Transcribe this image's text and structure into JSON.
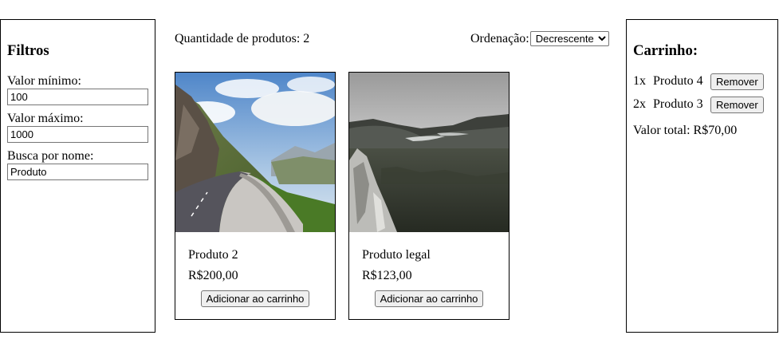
{
  "filters": {
    "title": "Filtros",
    "min_label": "Valor mínimo:",
    "min_value": "100",
    "max_label": "Valor máximo:",
    "max_value": "1000",
    "name_label": "Busca por nome:",
    "name_value": "Produto"
  },
  "header": {
    "quantity_text": "Quantidade de produtos: 2",
    "sort_label": "Ordenação:",
    "sort_selected": "Decrescente"
  },
  "products": [
    {
      "name": "Produto 2",
      "price": "R$200,00",
      "button": "Adicionar ao carrinho",
      "image": "mountain-road-photo"
    },
    {
      "name": "Produto legal",
      "price": "R$123,00",
      "button": "Adicionar ao carrinho",
      "image": "valley-landscape-photo"
    }
  ],
  "cart": {
    "title": "Carrinho:",
    "items": [
      {
        "qty": "1x",
        "name": "Produto 4",
        "button": "Remover"
      },
      {
        "qty": "2x",
        "name": "Produto 3",
        "button": "Remover"
      }
    ],
    "total": "Valor total: R$70,00"
  }
}
